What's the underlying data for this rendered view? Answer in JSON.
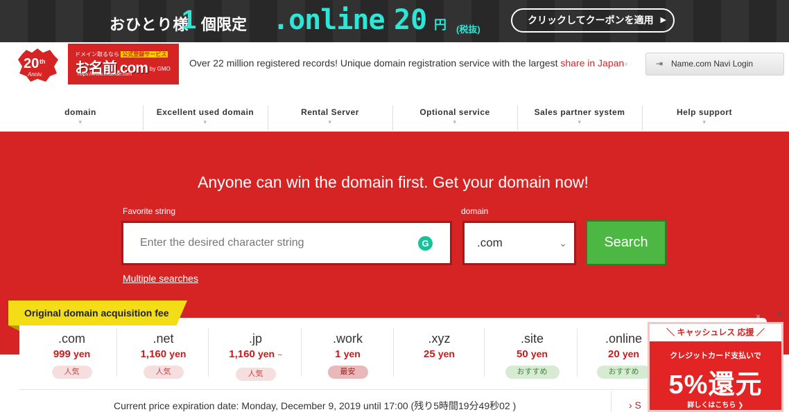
{
  "banner": {
    "text1": "おひとり様",
    "num": "1",
    "text2": "個限定",
    "tld": ".online",
    "price": "20",
    "yen": "円",
    "tax": "(税抜)",
    "cta": "クリックしてクーポンを適用",
    "cta_arrow": "▶"
  },
  "header": {
    "logo20_text": "20th Anniv.",
    "logo_small": "ドメイン取るなら",
    "logo_badge": "公式登録サービス",
    "logo_name": "お名前.com",
    "logo_url": "https://www.onamae.com",
    "logo_gmo": "by GMO",
    "tagline_main": "Over 22 million registered records! Unique domain registration service with the largest ",
    "tagline_red": "share in Japan",
    "tagline_close": "×",
    "login": "Name.com Navi Login"
  },
  "nav": [
    {
      "label": "domain"
    },
    {
      "label": "Excellent used domain"
    },
    {
      "label": "Rental Server"
    },
    {
      "label": "Optional service"
    },
    {
      "label": "Sales partner system"
    },
    {
      "label": "Help support"
    }
  ],
  "hero": {
    "title": "Anyone can win the domain first. Get your domain now!",
    "favorite_label": "Favorite string",
    "domain_label": "domain",
    "search_placeholder": "Enter the desired character string",
    "grammarly": "G",
    "domain_value": ".com",
    "search_button": "Search",
    "multiple_link": "Multiple searches"
  },
  "fees": {
    "tag": "Original domain acquisition fee",
    "close": "×",
    "items": [
      {
        "name": ".com",
        "price": "999",
        "unit": "yen",
        "suffix": "",
        "badge": "人気"
      },
      {
        "name": ".net",
        "price": "1,160",
        "unit": "yen",
        "suffix": "",
        "badge": "人気"
      },
      {
        "name": ".jp",
        "price": "1,160",
        "unit": "yen",
        "suffix": "~",
        "badge": "人気"
      },
      {
        "name": ".work",
        "price": "1",
        "unit": "yen",
        "suffix": "",
        "badge": "最安"
      },
      {
        "name": ".xyz",
        "price": "25",
        "unit": "yen",
        "suffix": "",
        "badge": ""
      },
      {
        "name": ".site",
        "price": "50",
        "unit": "yen",
        "suffix": "",
        "badge": "おすすめ"
      },
      {
        "name": ".online",
        "price": "20",
        "unit": "yen",
        "suffix": "",
        "badge": "おすすめ"
      }
    ],
    "expiry": "Current price expiration date: Monday, December 9, 2019 until 17:00 (残り5時間19分49秒02 )",
    "more": "›  S"
  },
  "ad": {
    "top": "＼ キャッシュレス 応援 ／",
    "sub": "クレジットカード支払いで",
    "big": "5%還元",
    "more": "詳しくはこちら ❯",
    "close": "×"
  },
  "colors": {
    "brand_red": "#d62424",
    "search_green": "#4cb843",
    "banner_cyan": "#2ee6d6",
    "tag_yellow": "#f2dd17"
  }
}
